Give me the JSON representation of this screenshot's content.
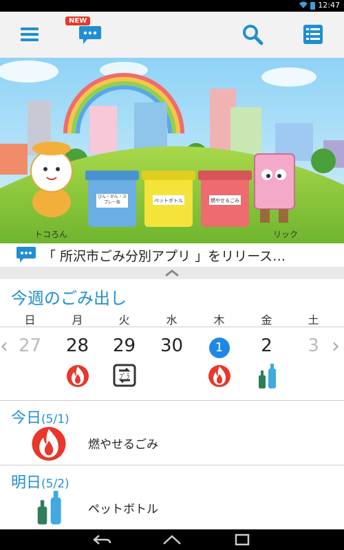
{
  "status_bar": {
    "time": "12:47"
  },
  "toolbar": {
    "new_badge": "NEW"
  },
  "banner": {
    "char_left": "トコろん",
    "char_right": "リック",
    "bin1_label": "びん・かん・スプレー缶",
    "bin2_label": "ペットボトル",
    "bin3_label": "燃やせるごみ"
  },
  "news": {
    "text": "「 所沢市ごみ分別アプリ 」をリリース…"
  },
  "week": {
    "title": "今週のごみ出し",
    "days": [
      {
        "weekday": "日",
        "date": "27"
      },
      {
        "weekday": "月",
        "date": "28"
      },
      {
        "weekday": "火",
        "date": "29"
      },
      {
        "weekday": "水",
        "date": "30"
      },
      {
        "weekday": "木",
        "date": "1"
      },
      {
        "weekday": "金",
        "date": "2"
      },
      {
        "weekday": "土",
        "date": "3"
      }
    ]
  },
  "today": {
    "title": "今日",
    "date": "(5/1)",
    "item": "燃やせるごみ"
  },
  "tomorrow": {
    "title": "明日",
    "date": "(5/2)",
    "item": "ペットボトル"
  },
  "colors": {
    "accent": "#1f8fd3",
    "flame": "#e8372b",
    "bottle_green": "#2e7d5b",
    "bottle_blue": "#3fa9e0"
  },
  "icons": [
    "menu-icon",
    "chat-icon",
    "search-icon",
    "list-icon",
    "flame-icon",
    "recycle-icon",
    "bottles-icon",
    "back-icon",
    "home-icon",
    "recent-apps-icon"
  ]
}
